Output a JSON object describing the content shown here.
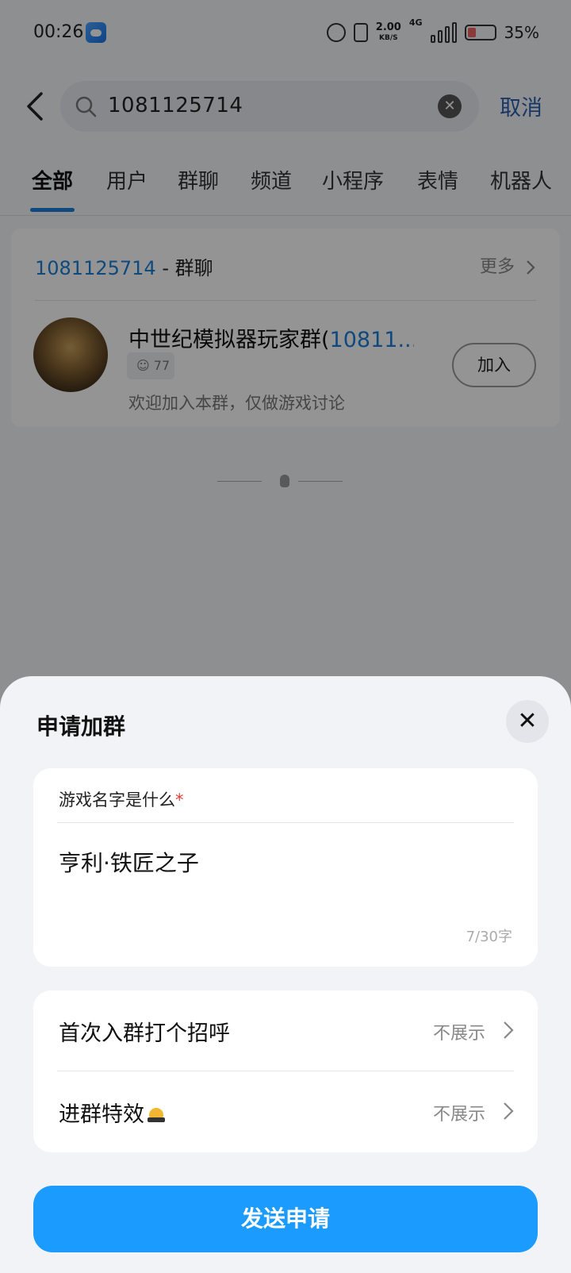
{
  "status_bar": {
    "time": "00:26",
    "net_speed_value": "2.00",
    "net_speed_unit": "KB/S",
    "network_type": "4G",
    "battery": "35%"
  },
  "search": {
    "query": "1081125714",
    "cancel_label": "取消"
  },
  "tabs": [
    {
      "label": "全部",
      "active": true
    },
    {
      "label": "用户"
    },
    {
      "label": "群聊"
    },
    {
      "label": "频道"
    },
    {
      "label": "小程序"
    },
    {
      "label": "表情"
    },
    {
      "label": "机器人"
    }
  ],
  "result": {
    "keyword": "1081125714",
    "type_label": " - 群聊",
    "more_label": "更多",
    "group_name_prefix": "中世纪模拟器玩家群(",
    "group_name_number": "10811...",
    "member_count": "77",
    "description": "欢迎加入本群，仅做游戏讨论",
    "join_label": "加入"
  },
  "sheet": {
    "title": "申请加群",
    "close_icon": "close-icon",
    "question_label": "游戏名字是什么",
    "question_required_mark": "*",
    "answer": "亨利·铁匠之子",
    "char_count": "7/30字",
    "options": [
      {
        "label": "首次入群打个招呼",
        "value": "不展示"
      },
      {
        "label": "进群特效",
        "value": "不展示"
      }
    ],
    "send_label": "发送申请"
  },
  "colors": {
    "accent": "#1a9bfd",
    "link": "#1a7fd8",
    "cancel": "#2a5db0",
    "required": "#e53935"
  }
}
